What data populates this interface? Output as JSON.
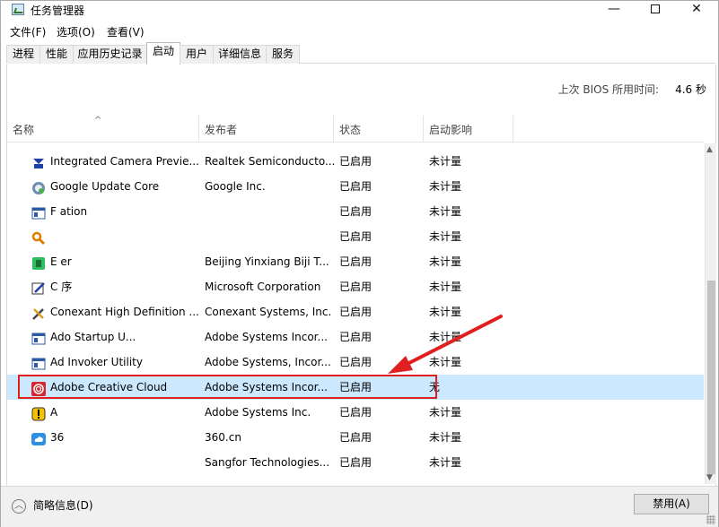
{
  "window": {
    "title": "任务管理器",
    "controls": {
      "minimize": "—",
      "close": "✕"
    }
  },
  "menu": [
    "文件(F)",
    "选项(O)",
    "查看(V)"
  ],
  "tabs": [
    "进程",
    "性能",
    "应用历史记录",
    "启动",
    "用户",
    "详细信息",
    "服务"
  ],
  "active_tab": "启动",
  "bios": {
    "label": "上次 BIOS 所用时间:",
    "value": "4.6 秒"
  },
  "columns": [
    "名称",
    "发布者",
    "状态",
    "启动影响"
  ],
  "rows": [
    {
      "name": "Integrated Camera Previe...",
      "publisher": "Realtek Semiconducto...",
      "status": "已启用",
      "impact": "未计量",
      "icon": "camera-icon"
    },
    {
      "name": "Google Update Core",
      "publisher": "Google Inc.",
      "status": "已启用",
      "impact": "未计量",
      "icon": "google-update-icon"
    },
    {
      "name": "F            ation",
      "publisher": "",
      "status": "已启用",
      "impact": "未计量",
      "icon": "app-window-icon"
    },
    {
      "name": "",
      "publisher": "",
      "status": "已启用",
      "impact": "未计量",
      "icon": "search-key-icon"
    },
    {
      "name": "E              er",
      "publisher": "Beijing Yinxiang Biji T...",
      "status": "已启用",
      "impact": "未计量",
      "icon": "evernote-icon"
    },
    {
      "name": "C              序",
      "publisher": "Microsoft Corporation",
      "status": "已启用",
      "impact": "未计量",
      "icon": "pen-icon"
    },
    {
      "name": "Conexant High Definition ...",
      "publisher": "Conexant Systems, Inc.",
      "status": "已启用",
      "impact": "未计量",
      "icon": "tools-icon"
    },
    {
      "name": "Ado          Startup U...",
      "publisher": "Adobe Systems Incor...",
      "status": "已启用",
      "impact": "未计量",
      "icon": "app-window-icon"
    },
    {
      "name": "Ad          Invoker Utility",
      "publisher": "Adobe Systems, Incor...",
      "status": "已启用",
      "impact": "未计量",
      "icon": "app-window-icon"
    },
    {
      "name": "Adobe Creative Cloud",
      "publisher": "Adobe Systems Incor...",
      "status": "已启用",
      "impact": "无",
      "icon": "creative-cloud-icon",
      "selected": true
    },
    {
      "name": "A",
      "publisher": "Adobe Systems Inc.",
      "status": "已启用",
      "impact": "未计量",
      "icon": "warning-icon"
    },
    {
      "name": "36",
      "publisher": "360.cn",
      "status": "已启用",
      "impact": "未计量",
      "icon": "cloud-360-icon"
    },
    {
      "name": "",
      "publisher": "Sangfor Technologies...",
      "status": "已启用",
      "impact": "未计量",
      "icon": "none"
    }
  ],
  "footer": {
    "fewer_details": "简略信息(D)",
    "disable_button": "禁用(A)"
  },
  "colors": {
    "selected_row": "#cce8ff",
    "annotation": "#e02020"
  }
}
